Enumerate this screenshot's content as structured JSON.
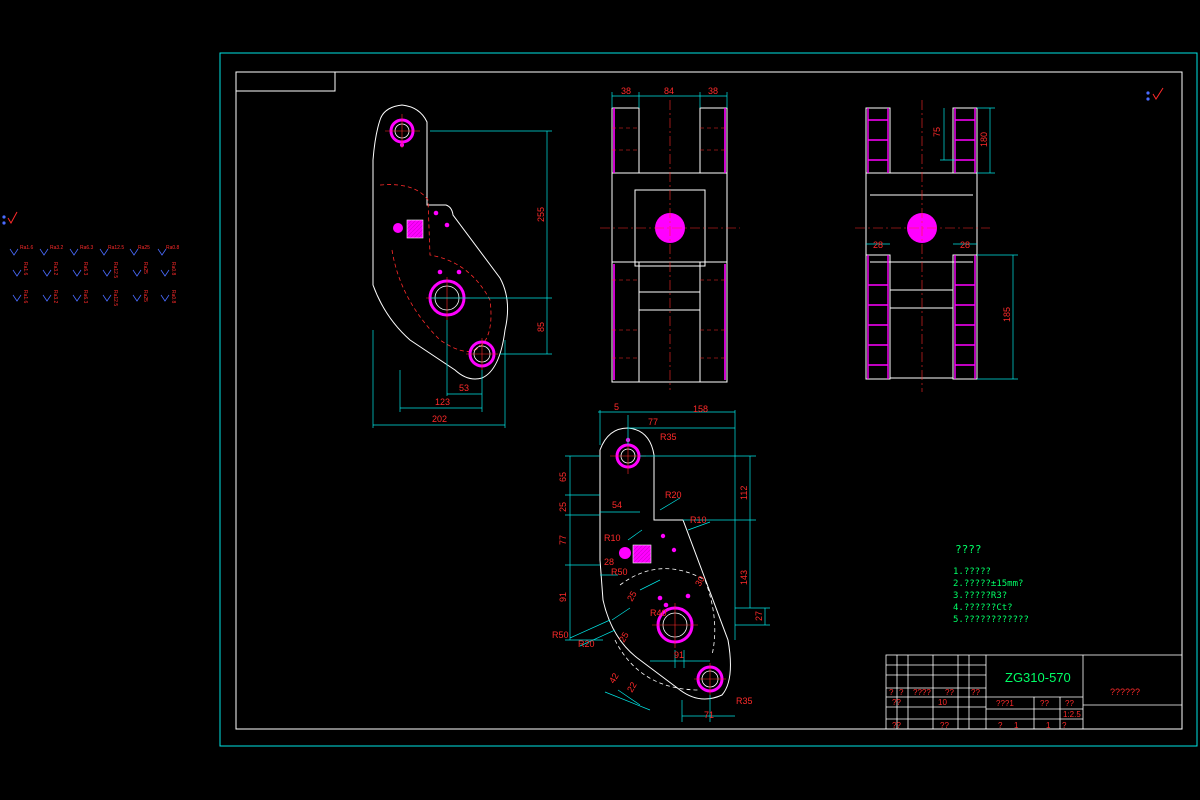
{
  "colors": {
    "background": "#000000",
    "outline": "#ffffff",
    "border": "#00e5e5",
    "dimension": "#00e5e5",
    "dimension_text": "#ff2a2a",
    "center_line": "#ff2a2a",
    "hidden_line": "#ff2a2a",
    "hatch": "#ff00ff",
    "note_text": "#00ff66"
  },
  "icons": [
    "roughness-symbol-icon",
    "checkmark-icon"
  ],
  "symbols_panel": {
    "row1": [
      "Ra1.6",
      "Ra3.2",
      "Ra6.3",
      "Ra12.5",
      "Ra25",
      "Ra0.8"
    ],
    "row2": [
      "Ra1.6",
      "Ra3.2",
      "Ra6.3",
      "Ra12.5",
      "Ra25",
      "Ra0.8"
    ],
    "row3": [
      "Ra1.6",
      "Ra3.2",
      "Ra6.3",
      "Ra12.5",
      "Ra25",
      "Ra0.8"
    ]
  },
  "front_view": {
    "dims": {
      "d255": "255",
      "d85": "85",
      "d53": "53",
      "d123": "123",
      "d202": "202"
    }
  },
  "top_view": {
    "dims": {
      "d38a": "38",
      "d84": "84",
      "d38b": "38"
    }
  },
  "side_view": {
    "dims": {
      "d75": "75",
      "d180": "180",
      "d28a": "28",
      "d28b": "28",
      "d185": "185"
    }
  },
  "section_view": {
    "dims": {
      "d5": "5",
      "d77t": "77",
      "d158": "158",
      "r35t": "R35",
      "r20a": "R20",
      "r10a": "R10",
      "r10b": "R10",
      "d112": "112",
      "d65": "65",
      "d54": "54",
      "d25a": "25",
      "d77l": "77",
      "d28": "28",
      "r50a": "R50",
      "d91l": "91",
      "d25b": "25",
      "r50b": "R50",
      "r20b": "R20",
      "d25c": "25",
      "r40": "R40",
      "d30": "30",
      "d143": "143",
      "d27": "27",
      "d91b": "91",
      "d42": "42",
      "d22": "22",
      "r35b": "R35",
      "d71": "71"
    }
  },
  "notes": {
    "title": "????",
    "lines": [
      "1.?????",
      "2.?????±15mm?",
      "3.?????R3?",
      "4.??????Ct?",
      "5.????????????"
    ]
  },
  "title_block": {
    "material": "ZG310-570",
    "name": "??????",
    "cells": {
      "c1": "?",
      "c2": "?",
      "c3": "????",
      "c4": "??",
      "c5": "??",
      "c6": "??",
      "c7": "10",
      "c8": "???1",
      "c9": "??",
      "c10": "??",
      "c11": "1:2.5",
      "c12": "??",
      "c13": "??",
      "c14": "?",
      "c15": "1",
      "c16": "1",
      "c17": "?"
    }
  }
}
